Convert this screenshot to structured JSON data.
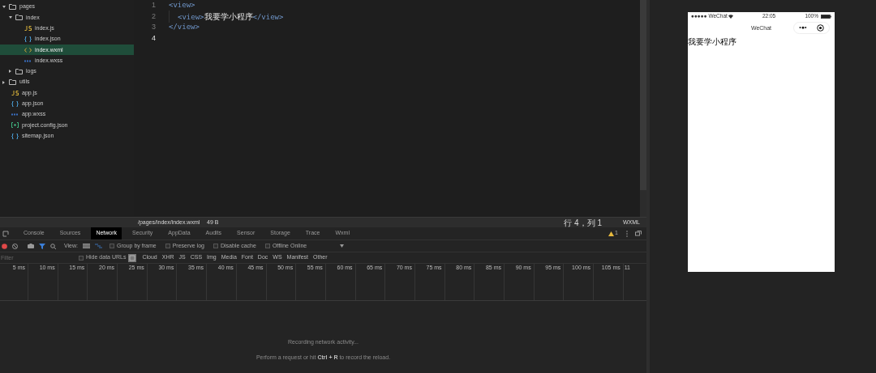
{
  "file_tree": [
    {
      "label": "pages",
      "kind": "folder",
      "expanded": true,
      "selected": false,
      "children": [
        {
          "label": "index",
          "kind": "folder",
          "expanded": true,
          "selected": false,
          "children": [
            {
              "label": "index.js",
              "kind": "js",
              "selected": false
            },
            {
              "label": "index.json",
              "kind": "json",
              "selected": false
            },
            {
              "label": "index.wxml",
              "kind": "wxml",
              "selected": true
            },
            {
              "label": "index.wxss",
              "kind": "wxss",
              "selected": false
            }
          ]
        },
        {
          "label": "logs",
          "kind": "folder",
          "expanded": false,
          "selected": false
        }
      ]
    },
    {
      "label": "utils",
      "kind": "folder",
      "expanded": false,
      "selected": false
    },
    {
      "label": "app.js",
      "kind": "js",
      "selected": false
    },
    {
      "label": "app.json",
      "kind": "json",
      "selected": false
    },
    {
      "label": "app.wxss",
      "kind": "wxss",
      "selected": false
    },
    {
      "label": "project.config.json",
      "kind": "config",
      "selected": false
    },
    {
      "label": "sitemap.json",
      "kind": "json",
      "selected": false
    }
  ],
  "editor": {
    "lines": [
      {
        "number": "1",
        "current": false,
        "tokens": [
          {
            "kind": "tag",
            "text": "<view>"
          }
        ]
      },
      {
        "number": "2",
        "current": false,
        "tokens": [
          {
            "kind": "tag",
            "text": "<view>"
          },
          {
            "kind": "text",
            "text": "我要学小程序"
          },
          {
            "kind": "tag",
            "text": "</view>"
          }
        ]
      },
      {
        "number": "3",
        "current": false,
        "tokens": [
          {
            "kind": "tag",
            "text": "</view>"
          }
        ]
      },
      {
        "number": "4",
        "current": true
      }
    ]
  },
  "status_bar": {
    "path": "/pages/index/index.wxml",
    "size": "49 B",
    "position": "行 4，列 1",
    "language": "WXML"
  },
  "devtools": {
    "tabs": [
      {
        "label": "Console",
        "selected": false
      },
      {
        "label": "Sources",
        "selected": false
      },
      {
        "label": "Network",
        "selected": true
      },
      {
        "label": "Security",
        "selected": false
      },
      {
        "label": "AppData",
        "selected": false
      },
      {
        "label": "Audits",
        "selected": false
      },
      {
        "label": "Sensor",
        "selected": false
      },
      {
        "label": "Storage",
        "selected": false
      },
      {
        "label": "Trace",
        "selected": false
      },
      {
        "label": "Wxml",
        "selected": false
      }
    ],
    "warnings": "1",
    "view_label": "View:",
    "options": [
      {
        "label": "Group by frame",
        "checked": false
      },
      {
        "label": "Preserve log",
        "checked": false
      },
      {
        "label": "Disable cache",
        "checked": false
      },
      {
        "label": "Offline",
        "checked": false
      }
    ],
    "throttling": "Online",
    "filter": {
      "placeholder": "Filter"
    },
    "hide_data_urls": {
      "label": "Hide data URLs",
      "checked": false
    },
    "types": [
      "Cloud",
      "XHR",
      "JS",
      "CSS",
      "Img",
      "Media",
      "Font",
      "Doc",
      "WS",
      "Manifest",
      "Other"
    ],
    "timeline_ticks": [
      "5 ms",
      "10 ms",
      "15 ms",
      "20 ms",
      "25 ms",
      "30 ms",
      "35 ms",
      "40 ms",
      "45 ms",
      "50 ms",
      "55 ms",
      "60 ms",
      "65 ms",
      "70 ms",
      "75 ms",
      "80 ms",
      "85 ms",
      "90 ms",
      "95 ms",
      "100 ms",
      "105 ms",
      "11"
    ],
    "empty_title": "Recording network activity...",
    "empty_hint": "Perform a request or hit **Ctrl + R** to record the reload."
  },
  "phone": {
    "carrier": "●●●●● WeChat",
    "time": "22:05",
    "battery": "100%",
    "nav_title": "WeChat",
    "capsule_more": "•●•",
    "content": "我要学小程序"
  }
}
